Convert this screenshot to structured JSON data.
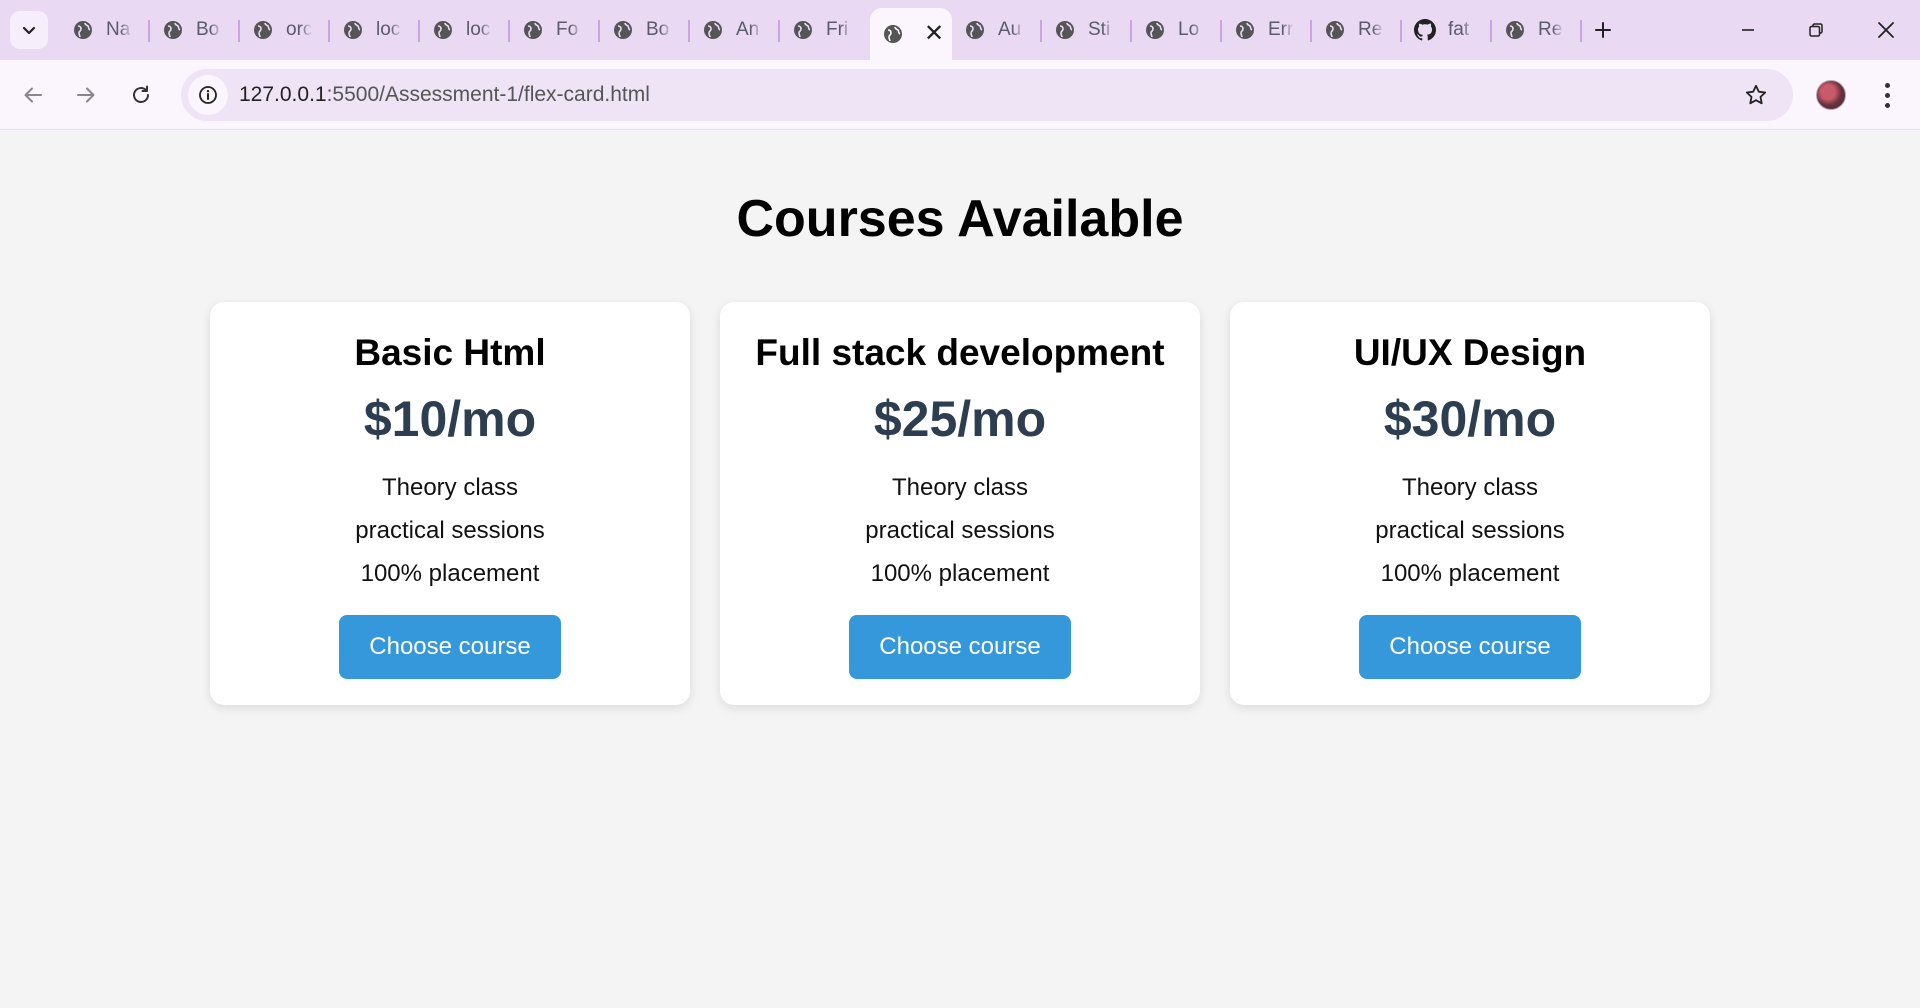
{
  "browser": {
    "tabs": [
      {
        "title": "Na",
        "icon": "globe-icon"
      },
      {
        "title": "Bo",
        "icon": "globe-icon"
      },
      {
        "title": "orc",
        "icon": "globe-icon"
      },
      {
        "title": "loc",
        "icon": "globe-icon"
      },
      {
        "title": "loc",
        "icon": "globe-icon"
      },
      {
        "title": "Fo",
        "icon": "globe-icon"
      },
      {
        "title": "Bo",
        "icon": "globe-icon"
      },
      {
        "title": "An",
        "icon": "globe-icon"
      },
      {
        "title": "Fri",
        "icon": "globe-icon"
      },
      {
        "title": "",
        "icon": "globe-icon",
        "active": true
      },
      {
        "title": "Au",
        "icon": "globe-icon"
      },
      {
        "title": "Sti",
        "icon": "globe-icon"
      },
      {
        "title": "Lo",
        "icon": "globe-icon"
      },
      {
        "title": "Err",
        "icon": "globe-icon"
      },
      {
        "title": "Re",
        "icon": "globe-icon"
      },
      {
        "title": "fat",
        "icon": "github-icon"
      },
      {
        "title": "Re",
        "icon": "globe-icon"
      }
    ],
    "address": {
      "host": "127.0.0.1",
      "path": ":5500/Assessment-1/flex-card.html"
    }
  },
  "page": {
    "title": "Courses Available",
    "cards": [
      {
        "title": "Basic Html",
        "price": "$10/mo",
        "features": [
          "Theory class",
          "practical sessions",
          "100% placement"
        ],
        "button": "Choose course"
      },
      {
        "title": "Full stack development",
        "price": "$25/mo",
        "features": [
          "Theory class",
          "practical sessions",
          "100% placement"
        ],
        "button": "Choose course"
      },
      {
        "title": "UI/UX Design",
        "price": "$30/mo",
        "features": [
          "Theory class",
          "practical sessions",
          "100% placement"
        ],
        "button": "Choose course"
      }
    ]
  },
  "colors": {
    "tabstrip_bg": "#e9d9f3",
    "toolbar_bg": "#fbf6fe",
    "page_bg": "#f4f4f4",
    "price_text": "#2c3e50",
    "button_bg": "#3498db"
  }
}
